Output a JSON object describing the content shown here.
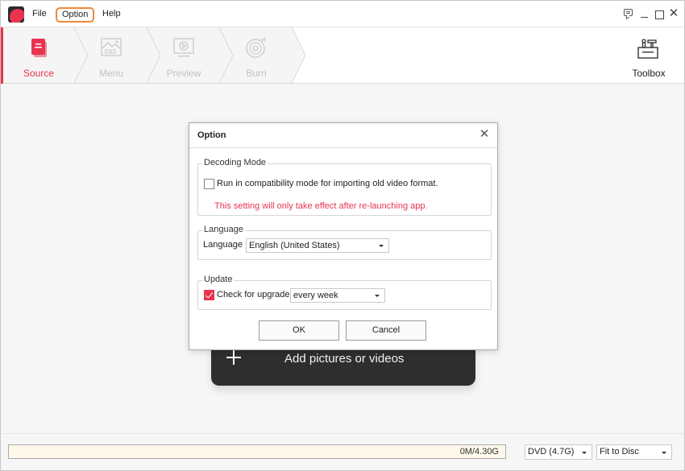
{
  "menu": {
    "items": [
      {
        "label": "File"
      },
      {
        "label": "Option",
        "highlighted": true
      },
      {
        "label": "Help"
      }
    ]
  },
  "window_controls": [
    "feedback-icon",
    "minimize-icon",
    "maximize-icon",
    "close-icon"
  ],
  "steps": [
    {
      "label": "Source",
      "icon": "source-icon",
      "active": true
    },
    {
      "label": "Menu",
      "icon": "menu-image-icon",
      "active": false
    },
    {
      "label": "Preview",
      "icon": "preview-icon",
      "active": false
    },
    {
      "label": "Burn",
      "icon": "burn-disc-icon",
      "active": false
    }
  ],
  "toolbox": {
    "label": "Toolbox",
    "icon": "toolbox-icon"
  },
  "add_media": {
    "label": "Add pictures or videos",
    "icon": "plus-icon"
  },
  "dialog": {
    "title": "Option",
    "decoding": {
      "group_title": "Decoding Mode",
      "checkbox_label": "Run in compatibility mode for importing old video format.",
      "checked": false,
      "warning": "This setting will only take effect after re-launching app."
    },
    "language": {
      "group_title": "Language",
      "label": "Language",
      "selected": "English (United States)"
    },
    "update": {
      "group_title": "Update",
      "checkbox_label": "Check for upgrade",
      "checked": true,
      "frequency": "every week"
    },
    "ok_label": "OK",
    "cancel_label": "Cancel"
  },
  "bottom": {
    "capacity_text": "0M/4.30G",
    "capacity_used_fraction": 0,
    "disc_type": "DVD (4.7G)",
    "fit_mode": "Fit to Disc"
  },
  "colors": {
    "accent": "#e8344f",
    "menu_highlight": "#f0893a",
    "add_button_bg": "#2e2e2e",
    "capacity_bg": "#fdf8ea"
  }
}
